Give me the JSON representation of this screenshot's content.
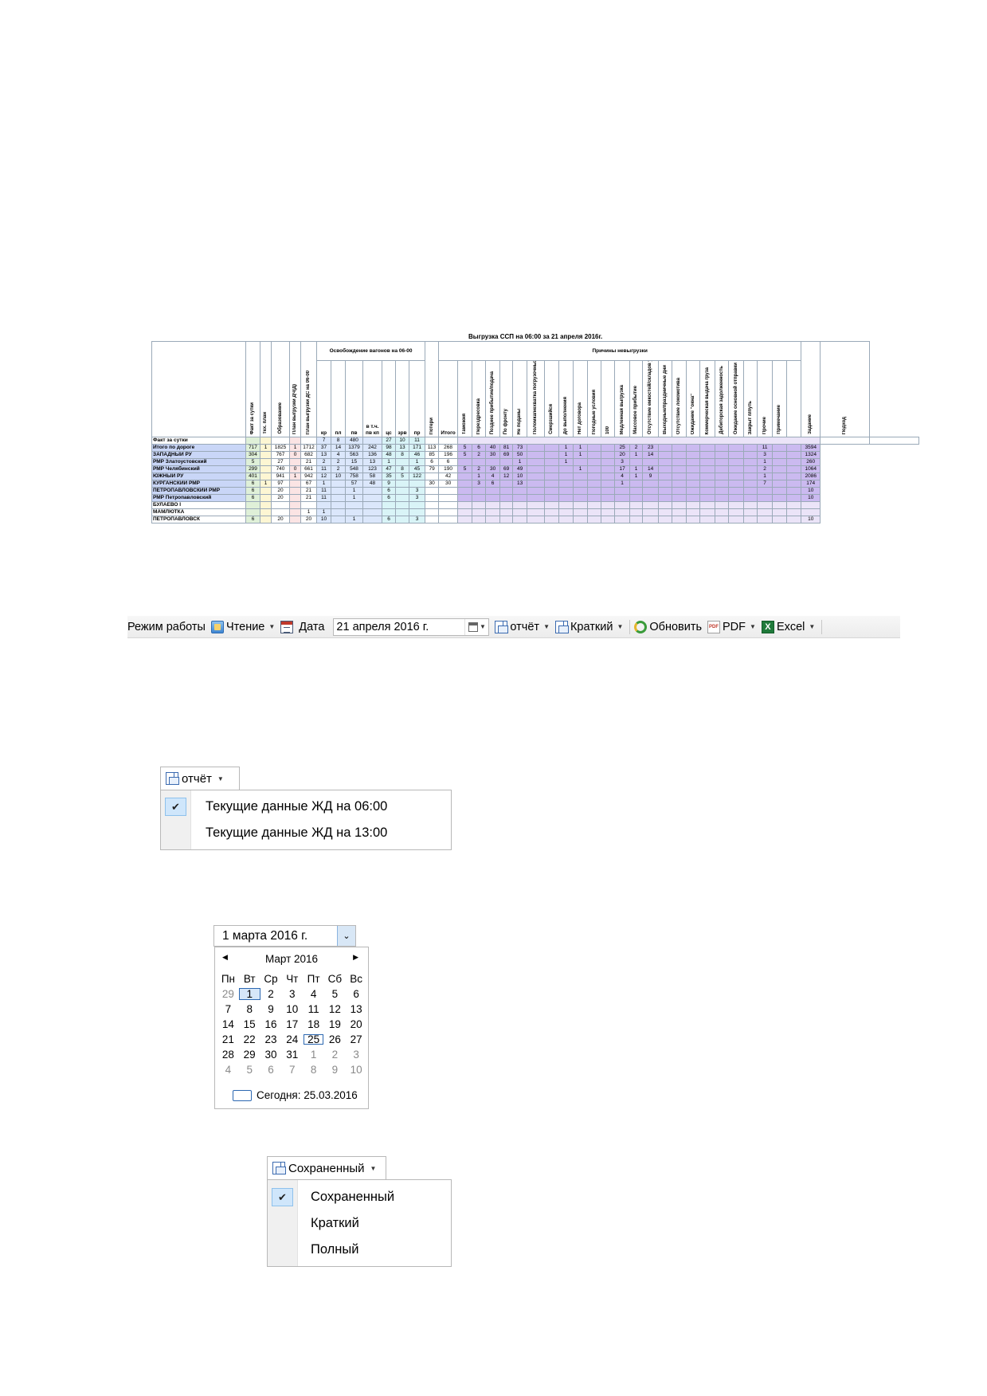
{
  "report": {
    "title": "Выгрузка ССП на 06:00 за 21 апреля 2016г.",
    "group_release": "Освобождение вагонов на 06-00",
    "group_reasons": "Причины невыгрузки",
    "col_fact": "Факт за сутки",
    "col_techplan": "Тех. план",
    "col_formation": "Образование",
    "col_plan_dchd": "План выгрузки ДЧ(Д)",
    "col_plan_ds": "План выгрузки ДС на 06-00",
    "col_kr": "кр",
    "col_pl": "пл",
    "col_pv": "пв",
    "col_pvkp": "в т.ч. пв кп",
    "col_cs": "цс",
    "col_zrv": "зрв",
    "col_pr": "пр",
    "col_losses": "Потери",
    "col_total": "Итого",
    "col_customs": "Таможня",
    "col_reweigh": "Перездресовка",
    "col_late": "Позднее прибытие/подача",
    "col_front": "По фронту",
    "col_notdelivered": "Не поданы",
    "col_breakdown": "Поломка/нехватка погрузочных ресурсов",
    "col_frozen": "Смерзшийся",
    "col_tofulfil": "До выполнения",
    "col_nocontract": "Нет договора",
    "col_weather": "Погодные условия",
    "col_100": "100",
    "col_slow": "Медленная выгрузка",
    "col_mass": "Массовое прибытие",
    "col_nocapacity": "Отсутствие емкостей/складов у грузополучателя",
    "col_holidays": "Выходные/праздничные дни",
    "col_nolocomotive": "Отсутствие локомотива",
    "col_window": "Ожидание \"окна\"",
    "col_commercial": "Коммерческая выдача груза",
    "col_debt": "Дебиторская задолженность",
    "col_waitmain": "Ожидание основной отправки",
    "col_closed": "Закрыт п/путь",
    "col_other": "Прочие",
    "col_note": "Примечание",
    "col_task": "Задание",
    "col_approach": "Подход",
    "row_header": "Факт за сутки",
    "hdr_values": [
      "7",
      "8",
      "480",
      "27",
      "10",
      "11"
    ],
    "rows": [
      {
        "name": "Итого по дороге",
        "v": [
          "717",
          "1",
          "1825",
          "1",
          "1712",
          "37",
          "14",
          "1379",
          "242",
          "98",
          "13",
          "171",
          "113",
          "268",
          "5",
          "6",
          "40",
          "81",
          "73",
          "",
          "",
          "1",
          "1",
          "",
          "",
          "25",
          "2",
          "23",
          "",
          "",
          "",
          "",
          "",
          "",
          "",
          "11",
          "",
          "",
          "3594"
        ]
      },
      {
        "name": "ЗАПАДНЫЙ РУ",
        "v": [
          "304",
          "",
          "767",
          "0",
          "682",
          "13",
          "4",
          "563",
          "136",
          "48",
          "8",
          "46",
          "85",
          "196",
          "5",
          "2",
          "30",
          "69",
          "50",
          "",
          "",
          "1",
          "1",
          "",
          "",
          "20",
          "1",
          "14",
          "",
          "",
          "",
          "",
          "",
          "",
          "",
          "3",
          "",
          "",
          "1324"
        ]
      },
      {
        "name": "РМР Златоустовский",
        "v": [
          "5",
          "",
          "27",
          "",
          "21",
          "2",
          "2",
          "15",
          "13",
          "1",
          "",
          "1",
          "6",
          "6",
          "",
          "",
          "",
          "",
          "1",
          "",
          "",
          "1",
          "",
          "",
          "",
          "3",
          "",
          "",
          "",
          "",
          "",
          "",
          "",
          "",
          "",
          "1",
          "",
          "",
          "260"
        ]
      },
      {
        "name": "РМР Челябинский",
        "v": [
          "299",
          "",
          "740",
          "0",
          "661",
          "11",
          "2",
          "548",
          "123",
          "47",
          "8",
          "45",
          "79",
          "190",
          "5",
          "2",
          "30",
          "69",
          "49",
          "",
          "",
          "",
          "1",
          "",
          "",
          "17",
          "1",
          "14",
          "",
          "",
          "",
          "",
          "",
          "",
          "",
          "2",
          "",
          "",
          "1064"
        ]
      },
      {
        "name": "ЮЖНЫЙ РУ",
        "v": [
          "401",
          "",
          "941",
          "1",
          "942",
          "12",
          "10",
          "758",
          "58",
          "35",
          "5",
          "122",
          "",
          "42",
          "",
          "1",
          "4",
          "12",
          "10",
          "",
          "",
          "",
          "",
          "",
          "",
          "4",
          "1",
          "9",
          "",
          "",
          "",
          "",
          "",
          "",
          "",
          "1",
          "",
          "",
          "2086"
        ]
      },
      {
        "name": "КУРГАНСКИЙ РМР",
        "v": [
          "6",
          "1",
          "97",
          "",
          "67",
          "1",
          "",
          "57",
          "48",
          "9",
          "",
          "",
          "30",
          "30",
          "",
          "3",
          "6",
          "",
          "13",
          "",
          "",
          "",
          "",
          "",
          "",
          "1",
          "",
          "",
          "",
          "",
          "",
          "",
          "",
          "",
          "",
          "7",
          "",
          "",
          "174"
        ]
      },
      {
        "name": "ПЕТРОПАВЛОВСКИЙ РМР",
        "v": [
          "6",
          "",
          "20",
          "",
          "21",
          "11",
          "",
          "1",
          "",
          "6",
          "",
          "3",
          "",
          "",
          "",
          "",
          "",
          "",
          "",
          "",
          "",
          "",
          "",
          "",
          "",
          "",
          "",
          "",
          "",
          "",
          "",
          "",
          "",
          "",
          "",
          "",
          "",
          "",
          "10"
        ]
      },
      {
        "name": "РМР Петропавловский",
        "v": [
          "6",
          "",
          "20",
          "",
          "21",
          "11",
          "",
          "1",
          "",
          "6",
          "",
          "3",
          "",
          "",
          "",
          "",
          "",
          "",
          "",
          "",
          "",
          "",
          "",
          "",
          "",
          "",
          "",
          "",
          "",
          "",
          "",
          "",
          "",
          "",
          "",
          "",
          "",
          "",
          "10"
        ]
      },
      {
        "name": "БУЛАЕВО I",
        "v": [
          "",
          "",
          "",
          "",
          "",
          "",
          "",
          "",
          "",
          "",
          "",
          "",
          "",
          "",
          "",
          "",
          "",
          "",
          "",
          "",
          "",
          "",
          "",
          "",
          "",
          "",
          "",
          "",
          "",
          "",
          "",
          "",
          "",
          "",
          "",
          "",
          "",
          "",
          ""
        ]
      },
      {
        "name": "МАМЛЮТКА",
        "v": [
          "",
          "",
          "",
          "",
          "1",
          "1",
          "",
          "",
          "",
          "",
          "",
          "",
          "",
          "",
          "",
          "",
          "",
          "",
          "",
          "",
          "",
          "",
          "",
          "",
          "",
          "",
          "",
          "",
          "",
          "",
          "",
          "",
          "",
          "",
          "",
          "",
          "",
          "",
          ""
        ]
      },
      {
        "name": "ПЕТРОПАВЛОВСК",
        "v": [
          "6",
          "",
          "20",
          "",
          "20",
          "10",
          "",
          "1",
          "",
          "6",
          "",
          "3",
          "",
          "",
          "",
          "",
          "",
          "",
          "",
          "",
          "",
          "",
          "",
          "",
          "",
          "",
          "",
          "",
          "",
          "",
          "",
          "",
          "",
          "",
          "",
          "",
          "",
          "",
          "10"
        ]
      }
    ]
  },
  "toolbar": {
    "mode_label": "Режим работы",
    "read_label": "Чтение",
    "date_label": "Дата",
    "date_value": "21  апреля   2016 г.",
    "report_label": "отчёт",
    "brief_label": "Краткий",
    "refresh_label": "Обновить",
    "pdf_label": "PDF",
    "excel_label": "Excel"
  },
  "report_menu": {
    "button_label": "отчёт",
    "items": [
      "Текущие данные ЖД на 06:00",
      "Текущие данные ЖД на 13:00"
    ],
    "checked_index": 0
  },
  "calendar": {
    "input_value": "1    марта    2016 г.",
    "month_title": "Март 2016",
    "weekdays": [
      "Пн",
      "Вт",
      "Ср",
      "Чт",
      "Пт",
      "Сб",
      "Вс"
    ],
    "weeks": [
      [
        "29",
        "1",
        "2",
        "3",
        "4",
        "5",
        "6"
      ],
      [
        "7",
        "8",
        "9",
        "10",
        "11",
        "12",
        "13"
      ],
      [
        "14",
        "15",
        "16",
        "17",
        "18",
        "19",
        "20"
      ],
      [
        "21",
        "22",
        "23",
        "24",
        "25",
        "26",
        "27"
      ],
      [
        "28",
        "29",
        "30",
        "31",
        "1",
        "2",
        "3"
      ],
      [
        "4",
        "5",
        "6",
        "7",
        "8",
        "9",
        "10"
      ]
    ],
    "selected": "1",
    "today": "25",
    "today_label": "Сегодня: 25.03.2016"
  },
  "view_menu": {
    "button_label": "Сохраненный",
    "items": [
      "Сохраненный",
      "Краткий",
      "Полный"
    ],
    "checked_index": 0
  }
}
